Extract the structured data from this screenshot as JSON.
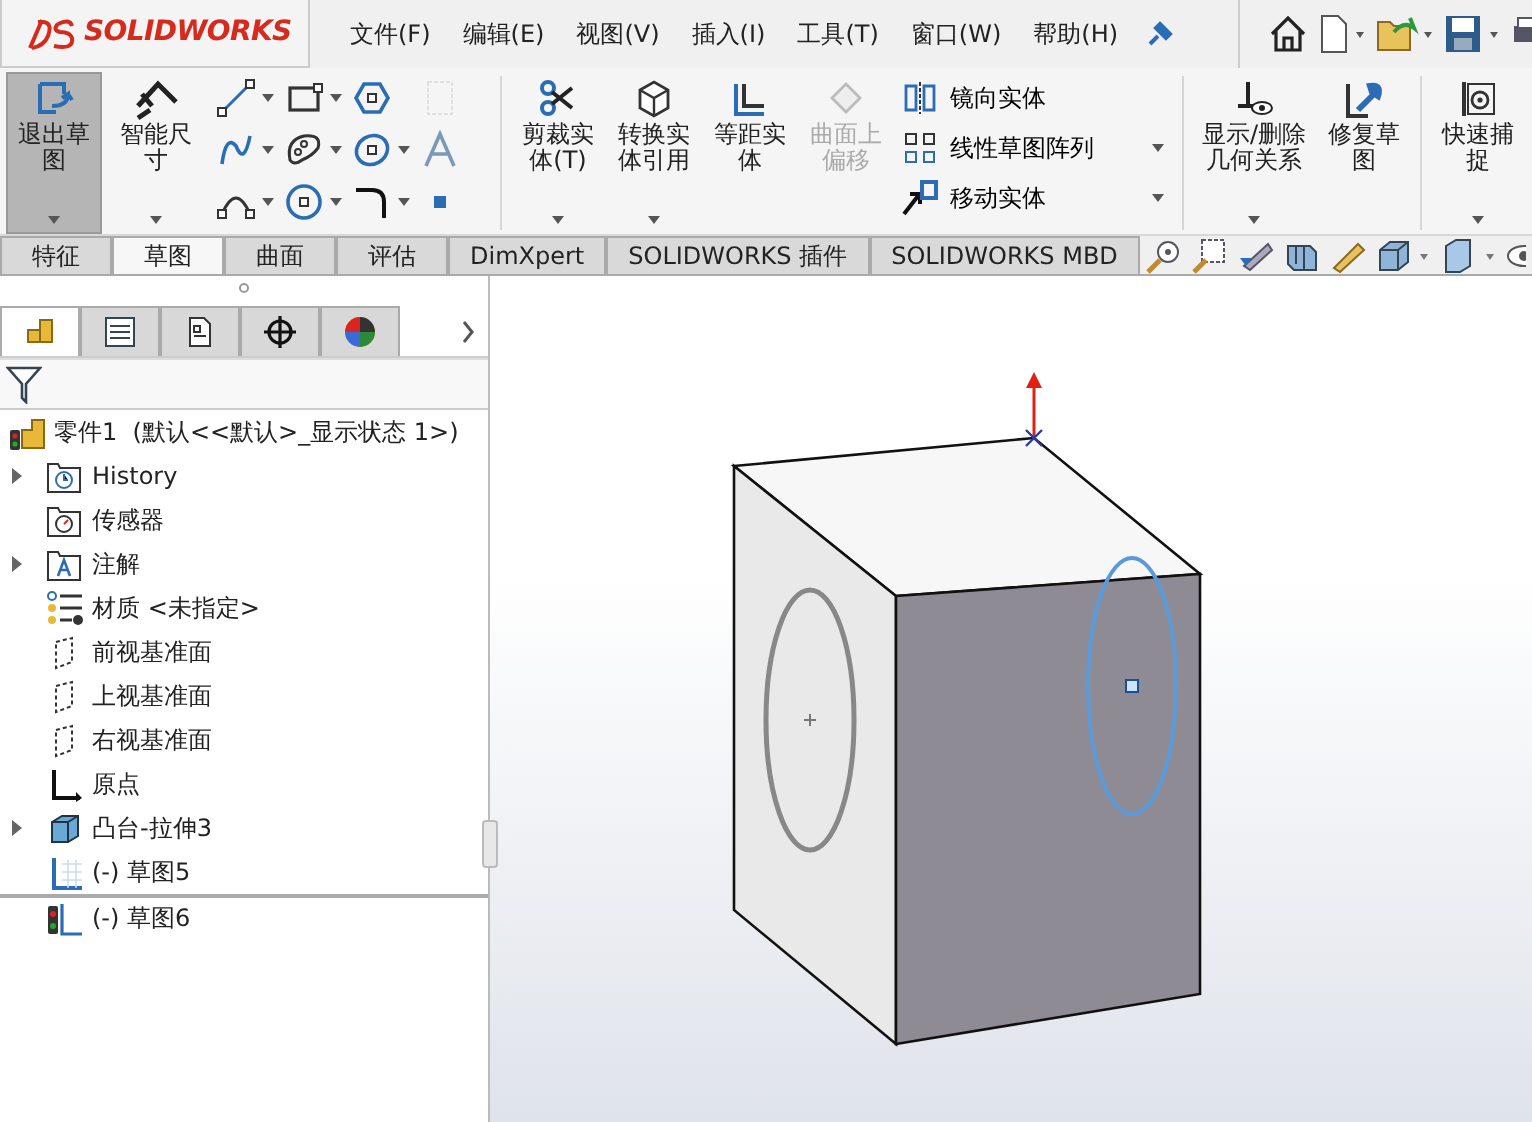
{
  "app": {
    "logo": "SOLIDWORKS"
  },
  "menu": [
    "文件(F)",
    "编辑(E)",
    "视图(V)",
    "插入(I)",
    "工具(T)",
    "窗口(W)",
    "帮助(H)"
  ],
  "ribbon": {
    "large_buttons_left": [
      {
        "label": "退出草图",
        "kind": "exit-sketch",
        "selected": true,
        "disabled": false,
        "has_menu": true
      },
      {
        "label": "智能尺寸",
        "kind": "dimension",
        "selected": false,
        "disabled": false,
        "has_menu": true
      }
    ],
    "sketch_tools": [
      {
        "kind": "line",
        "has_menu": true,
        "disabled": false
      },
      {
        "kind": "rectangle",
        "has_menu": true,
        "disabled": false
      },
      {
        "kind": "polygon",
        "has_menu": false,
        "disabled": false
      },
      {
        "kind": "grid",
        "has_menu": false,
        "disabled": true
      },
      {
        "kind": "spline",
        "has_menu": true,
        "disabled": false
      },
      {
        "kind": "blob",
        "has_menu": true,
        "disabled": false
      },
      {
        "kind": "ellipse",
        "has_menu": true,
        "disabled": false
      },
      {
        "kind": "text",
        "has_menu": false,
        "disabled": false
      },
      {
        "kind": "arc",
        "has_menu": true,
        "disabled": false
      },
      {
        "kind": "circle",
        "has_menu": true,
        "disabled": false
      },
      {
        "kind": "fillet",
        "has_menu": true,
        "disabled": false
      },
      {
        "kind": "point",
        "has_menu": false,
        "disabled": false
      }
    ],
    "large_buttons_mid": [
      {
        "label": "剪裁实体(T)",
        "kind": "trim",
        "selected": false,
        "disabled": false,
        "has_menu": true
      },
      {
        "label": "转换实体引用",
        "kind": "convert",
        "selected": false,
        "disabled": false,
        "has_menu": true
      },
      {
        "label": "等距实体",
        "kind": "offset",
        "selected": false,
        "disabled": false,
        "has_menu": false
      },
      {
        "label": "曲面上偏移",
        "kind": "surface-offset",
        "selected": false,
        "disabled": true,
        "has_menu": false
      }
    ],
    "list_buttons": [
      {
        "label": "镜向实体",
        "kind": "mirror",
        "has_menu": false
      },
      {
        "label": "线性草图阵列",
        "kind": "pattern",
        "has_menu": true
      },
      {
        "label": "移动实体",
        "kind": "move",
        "has_menu": true
      }
    ],
    "large_buttons_right": [
      {
        "label": "显示/删除几何关系",
        "kind": "relations",
        "selected": false,
        "disabled": false,
        "has_menu": true
      },
      {
        "label": "修复草图",
        "kind": "repair",
        "selected": false,
        "disabled": false,
        "has_menu": false
      },
      {
        "label": "快速捕捉",
        "kind": "snap",
        "selected": false,
        "disabled": false,
        "has_menu": true
      }
    ]
  },
  "tabs": [
    {
      "label": "特征",
      "selected": false
    },
    {
      "label": "草图",
      "selected": true
    },
    {
      "label": "曲面",
      "selected": false
    },
    {
      "label": "评估",
      "selected": false
    },
    {
      "label": "DimXpert",
      "selected": false
    },
    {
      "label": "SOLIDWORKS 插件",
      "selected": false
    },
    {
      "label": "SOLIDWORKS MBD",
      "selected": false
    }
  ],
  "panel_tabs": [
    {
      "kind": "feature-tree",
      "selected": true
    },
    {
      "kind": "properties",
      "selected": false
    },
    {
      "kind": "config",
      "selected": false
    },
    {
      "kind": "dimxpert",
      "selected": false
    },
    {
      "kind": "appearance",
      "selected": false
    }
  ],
  "tree": [
    {
      "label": "零件1  (默认<<默认>_显示状态 1>)",
      "kind": "part",
      "expandable": false
    },
    {
      "label": "History",
      "kind": "history",
      "expandable": true
    },
    {
      "label": "传感器",
      "kind": "sensor",
      "expandable": false
    },
    {
      "label": "注解",
      "kind": "annotation",
      "expandable": true
    },
    {
      "label": "材质 <未指定>",
      "kind": "material",
      "expandable": false
    },
    {
      "label": "前视基准面",
      "kind": "plane",
      "expandable": false
    },
    {
      "label": "上视基准面",
      "kind": "plane",
      "expandable": false
    },
    {
      "label": "右视基准面",
      "kind": "plane",
      "expandable": false
    },
    {
      "label": "原点",
      "kind": "origin",
      "expandable": false
    },
    {
      "label": "凸台-拉伸3",
      "kind": "extrude",
      "expandable": true
    },
    {
      "label": "(-) 草图5",
      "kind": "sketch",
      "expandable": false
    },
    {
      "label": "(-) 草图6",
      "kind": "sketch-rolled",
      "expandable": false
    }
  ]
}
